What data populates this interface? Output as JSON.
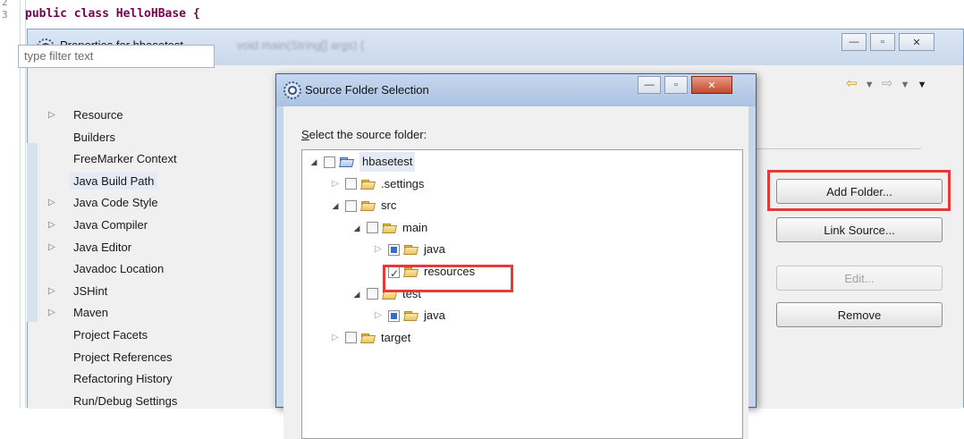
{
  "editor": {
    "line_numbers": [
      "2",
      "3"
    ],
    "code_line": "public class HelloHBase {",
    "ghost_text": "void main(String[] args) {"
  },
  "properties_dialog": {
    "title": "Properties for hbasetest",
    "window_buttons": {
      "minimize": "—",
      "maximize": "▫",
      "close": "✕"
    },
    "filter_placeholder": "type filter text",
    "nav_items": [
      {
        "label": "Resource",
        "expandable": true
      },
      {
        "label": "Builders",
        "expandable": false
      },
      {
        "label": "FreeMarker Context",
        "expandable": false
      },
      {
        "label": "Java Build Path",
        "expandable": false,
        "selected": true
      },
      {
        "label": "Java Code Style",
        "expandable": true
      },
      {
        "label": "Java Compiler",
        "expandable": true
      },
      {
        "label": "Java Editor",
        "expandable": true
      },
      {
        "label": "Javadoc Location",
        "expandable": false
      },
      {
        "label": "JSHint",
        "expandable": true
      },
      {
        "label": "Maven",
        "expandable": true
      },
      {
        "label": "Project Facets",
        "expandable": false
      },
      {
        "label": "Project References",
        "expandable": false
      },
      {
        "label": "Refactoring History",
        "expandable": false
      },
      {
        "label": "Run/Debug Settings",
        "expandable": false
      }
    ],
    "history_nav": {
      "back": "⇦",
      "forward": "⇨",
      "dropdown": "▼",
      "menu": "▼"
    },
    "buttons": {
      "add_folder": "Add Folder...",
      "link_source": "Link Source...",
      "edit": "Edit...",
      "remove": "Remove"
    }
  },
  "source_folder_dialog": {
    "title": "Source Folder Selection",
    "prompt": "Select the source folder:",
    "prompt_mnemonic": "S",
    "prompt_rest": "elect the source folder:",
    "window_buttons": {
      "minimize": "—",
      "maximize": "▫",
      "close": "✕"
    },
    "tree": [
      {
        "label": "hbasetest",
        "depth": 0,
        "expanded": true,
        "check": "none",
        "project": true
      },
      {
        "label": ".settings",
        "depth": 1,
        "expanded": false,
        "check": "none"
      },
      {
        "label": "src",
        "depth": 1,
        "expanded": true,
        "check": "none"
      },
      {
        "label": "main",
        "depth": 2,
        "expanded": true,
        "check": "none"
      },
      {
        "label": "java",
        "depth": 3,
        "expanded": false,
        "check": "partial"
      },
      {
        "label": "resources",
        "depth": 3,
        "expanded": null,
        "check": "checked"
      },
      {
        "label": "test",
        "depth": 2,
        "expanded": true,
        "check": "none"
      },
      {
        "label": "java",
        "depth": 3,
        "expanded": false,
        "check": "partial"
      },
      {
        "label": "target",
        "depth": 1,
        "expanded": false,
        "check": "none"
      }
    ]
  },
  "colors": {
    "highlight_red": "#e53a3a",
    "keyword": "#7a0055",
    "title_bar": "#c9d8ec"
  }
}
